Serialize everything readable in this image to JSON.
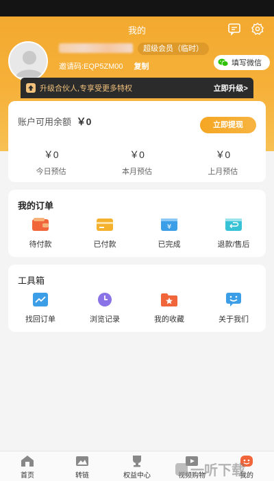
{
  "header": {
    "title": "我的"
  },
  "profile": {
    "member_level": "超级会员（临时）",
    "invite_code_label": "邀请码:EQP5ZM00",
    "copy_label": "复制",
    "wechat_button": "填写微信"
  },
  "upgrade": {
    "text": "升级合伙人,专享受更多特权",
    "link": "立即升级>"
  },
  "balance": {
    "label": "账户可用余额",
    "amount": "￥0",
    "withdraw_button": "立即提现",
    "stats": [
      {
        "value": "￥0",
        "label": "今日预估"
      },
      {
        "value": "￥0",
        "label": "本月预估"
      },
      {
        "value": "￥0",
        "label": "上月预估"
      }
    ]
  },
  "orders": {
    "title": "我的订单",
    "items": [
      {
        "label": "待付款",
        "icon": "wallet-icon",
        "color": "#f0663a"
      },
      {
        "label": "已付款",
        "icon": "card-icon",
        "color": "#f3b12e"
      },
      {
        "label": "已完成",
        "icon": "yuan-box-icon",
        "color": "#3d9ee8"
      },
      {
        "label": "退款/售后",
        "icon": "return-icon",
        "color": "#38c2d6"
      }
    ]
  },
  "tools": {
    "title": "工具箱",
    "items": [
      {
        "label": "找回订单",
        "icon": "chart-monitor-icon",
        "color": "#3d9ee8"
      },
      {
        "label": "浏览记录",
        "icon": "clock-icon",
        "color": "#8a73e6"
      },
      {
        "label": "我的收藏",
        "icon": "star-folder-icon",
        "color": "#f0663a"
      },
      {
        "label": "关于我们",
        "icon": "chat-smile-icon",
        "color": "#3d9ee8"
      }
    ]
  },
  "tabbar": {
    "items": [
      {
        "label": "首页",
        "icon": "home-icon"
      },
      {
        "label": "转链",
        "icon": "image-link-icon"
      },
      {
        "label": "权益中心",
        "icon": "trophy-icon"
      },
      {
        "label": "视频购物",
        "icon": "video-icon"
      },
      {
        "label": "我的",
        "icon": "profile-face-icon",
        "active": true
      }
    ]
  },
  "watermark": {
    "text": "一听下载"
  },
  "colors": {
    "primary": "#f5a623",
    "accent_dark": "#2b2b2b"
  }
}
